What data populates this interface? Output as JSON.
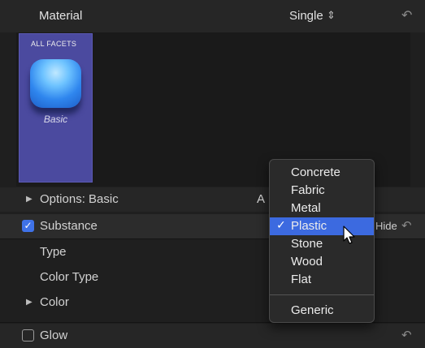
{
  "header": {
    "title": "Material",
    "mode": "Single",
    "mode_icon": "up-down-chevron-icon",
    "reset_icon": "reset-arrow-icon"
  },
  "material_tile": {
    "group_label": "ALL FACETS",
    "name": "Basic",
    "selected_color": "#4b4a9f"
  },
  "rows": {
    "options_label": "Options: Basic",
    "options_right_fragment": "A",
    "substance_label": "Substance",
    "substance_checked": true,
    "substance_hide": "Hide",
    "type_label": "Type",
    "color_type_label": "Color Type",
    "color_label": "Color",
    "glow_label": "Glow",
    "glow_checked": false
  },
  "dropdown": {
    "items": [
      "Concrete",
      "Fabric",
      "Metal",
      "Plastic",
      "Stone",
      "Wood",
      "Flat"
    ],
    "selected": "Plastic",
    "extra_item": "Generic",
    "accent": "#3c6ae0"
  }
}
